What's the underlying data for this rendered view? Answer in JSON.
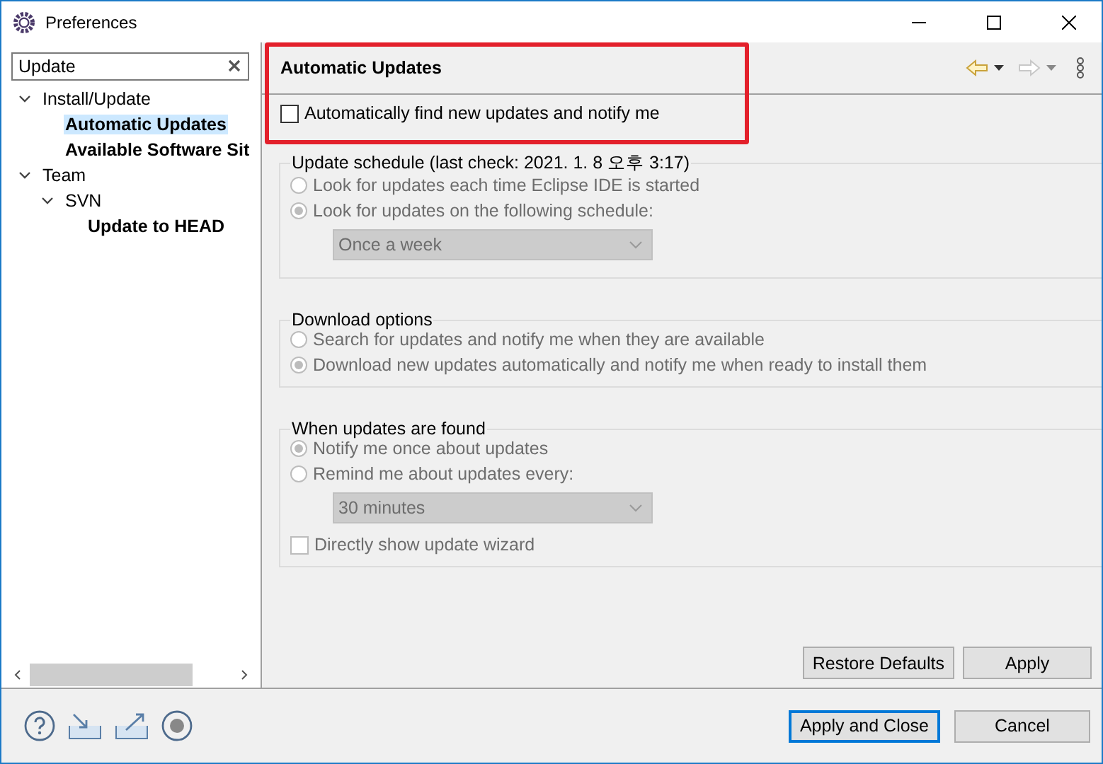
{
  "window": {
    "title": "Preferences"
  },
  "filter": {
    "value": "Update"
  },
  "tree": [
    {
      "label": "Install/Update",
      "expanded": true,
      "selected": false,
      "children": [
        {
          "label": "Automatic Updates",
          "selected": true
        },
        {
          "label": "Available Software Sit",
          "selected": false
        }
      ]
    },
    {
      "label": "Team",
      "expanded": true,
      "selected": false,
      "children": [
        {
          "label": "SVN",
          "expanded": true,
          "selected": false,
          "children": [
            {
              "label": "Update to HEAD",
              "selected": false
            }
          ]
        }
      ]
    }
  ],
  "page": {
    "title": "Automatic Updates",
    "highlighted": true,
    "auto_find": {
      "label": "Automatically find new updates and notify me",
      "checked": false
    },
    "groups": [
      {
        "title": "Update schedule (last check: 2021. 1. 8 오후 3:17)",
        "disabled": true,
        "items": [
          {
            "kind": "radio",
            "label": "Look for updates each time Eclipse IDE is started",
            "selected": false
          },
          {
            "kind": "radio",
            "label": "Look for updates on the following schedule:",
            "selected": true
          },
          {
            "kind": "dropdown",
            "value": "Once a week"
          }
        ]
      },
      {
        "title": "Download options",
        "disabled": true,
        "items": [
          {
            "kind": "radio",
            "label": "Search for updates and notify me when they are available",
            "selected": false
          },
          {
            "kind": "radio",
            "label": "Download new updates automatically and notify me when ready to install them",
            "selected": true
          }
        ]
      },
      {
        "title": "When updates are found",
        "disabled": true,
        "items": [
          {
            "kind": "radio",
            "label": "Notify me once about updates",
            "selected": true
          },
          {
            "kind": "radio",
            "label": "Remind me about updates every:",
            "selected": false
          },
          {
            "kind": "dropdown",
            "value": "30 minutes"
          },
          {
            "kind": "checkbox",
            "label": "Directly show update wizard",
            "checked": false
          }
        ]
      }
    ],
    "buttons": [
      "Restore Defaults",
      "Apply"
    ]
  },
  "footer": {
    "buttons": [
      {
        "label": "Apply and Close",
        "default": true
      },
      {
        "label": "Cancel",
        "default": false
      }
    ]
  }
}
